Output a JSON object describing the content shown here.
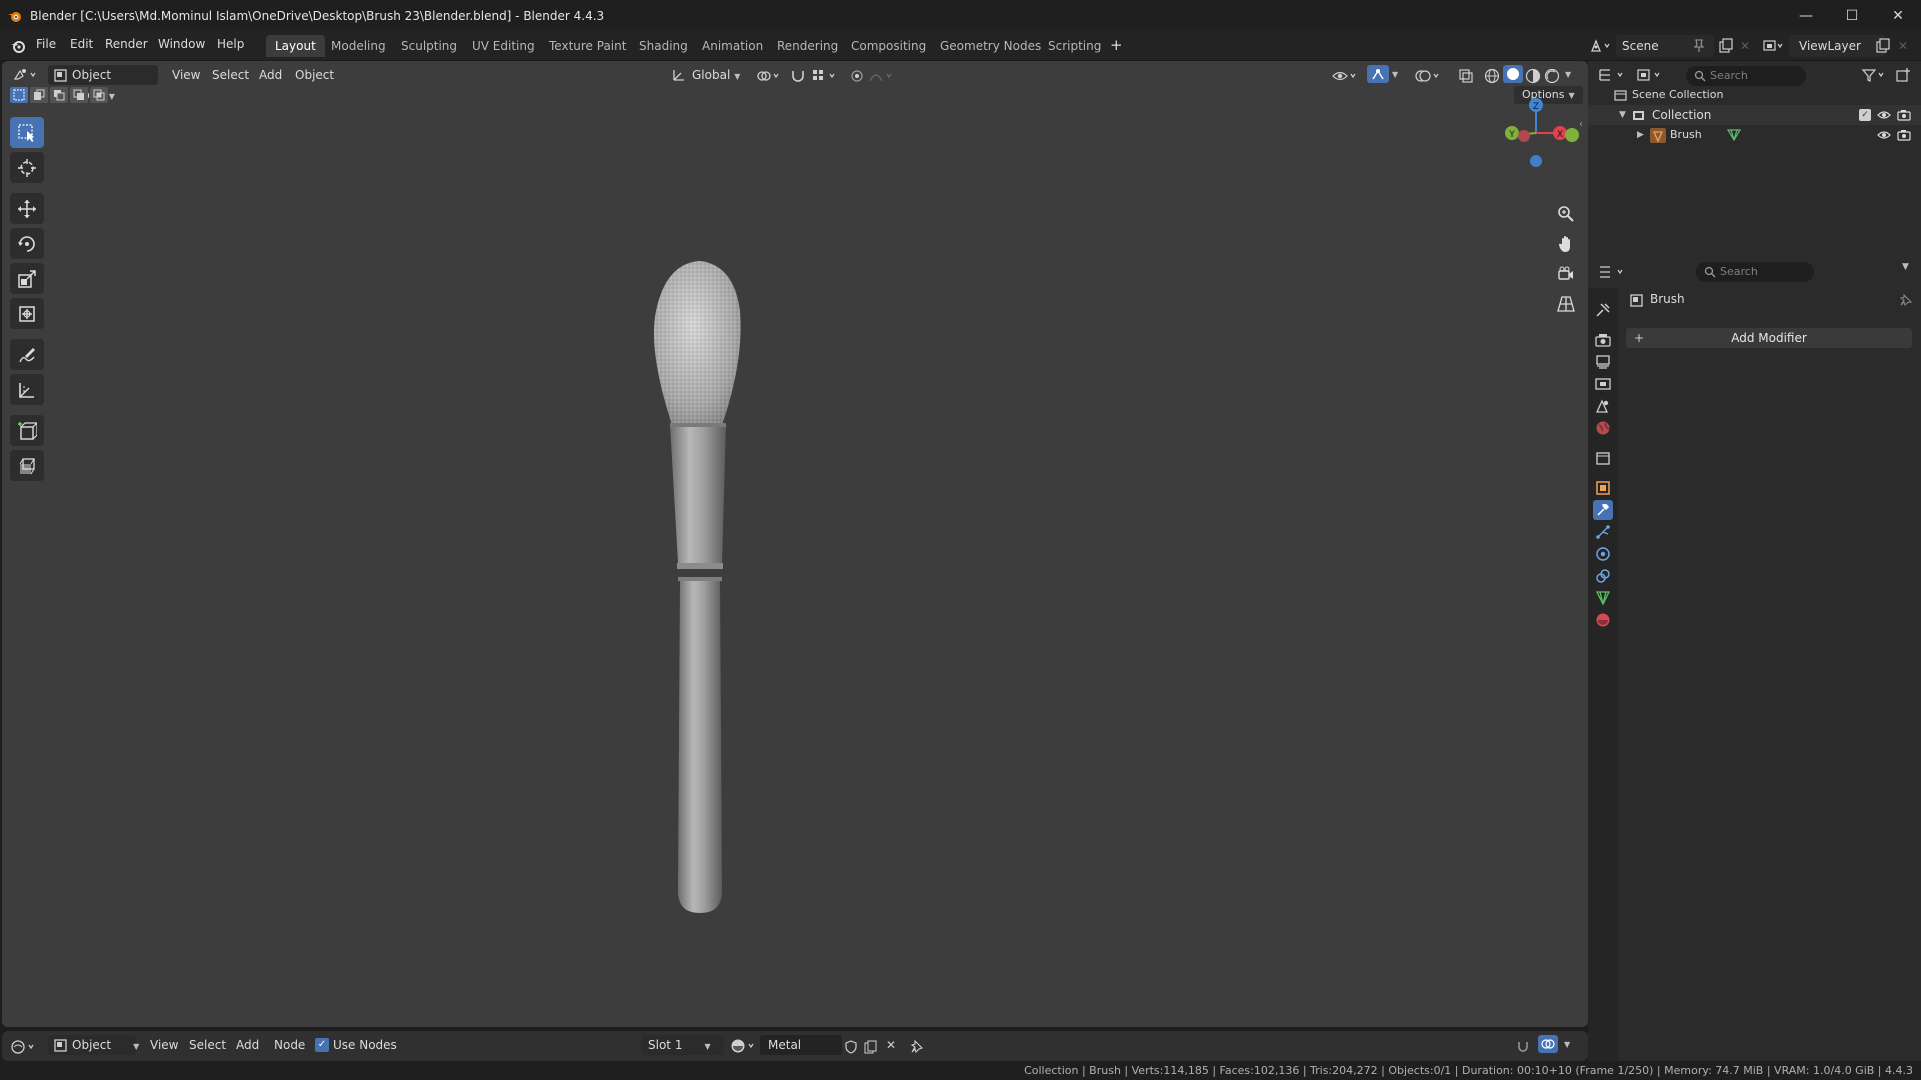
{
  "window": {
    "title": "Blender [C:\\Users\\Md.Mominul Islam\\OneDrive\\Desktop\\Brush 23\\Blender.blend] - Blender 4.4.3",
    "minimize": "—",
    "maximize": "☐",
    "close": "✕"
  },
  "menu": [
    "File",
    "Edit",
    "Render",
    "Window",
    "Help"
  ],
  "workspaces": [
    "Layout",
    "Modeling",
    "Sculpting",
    "UV Editing",
    "Texture Paint",
    "Shading",
    "Animation",
    "Rendering",
    "Compositing",
    "Geometry Nodes",
    "Scripting"
  ],
  "active_workspace": "Layout",
  "add_workspace": "+",
  "scene": {
    "name": "Scene",
    "view_layer": "ViewLayer"
  },
  "viewport": {
    "mode": "Object Mode",
    "menus": [
      "View",
      "Select",
      "Add",
      "Object"
    ],
    "orientation": "Global",
    "options": "Options",
    "gizmo": {
      "z": "Z",
      "y": "Y",
      "x": "X"
    }
  },
  "outliner": {
    "search_placeholder": "Search",
    "scene_collection": "Scene Collection",
    "collection": "Collection",
    "object": "Brush"
  },
  "properties": {
    "search_placeholder": "Search",
    "object_name": "Brush",
    "add_modifier": "Add Modifier",
    "add_modifier_icon": "+"
  },
  "shader_bar": {
    "mode": "Object",
    "menus": [
      "View",
      "Select",
      "Add",
      "Node"
    ],
    "use_nodes": "Use Nodes",
    "use_nodes_checked": true,
    "slot": "Slot 1",
    "material": "Metal"
  },
  "status": "Collection | Brush | Verts:114,185 | Faces:102,136 | Tris:204,272 | Objects:0/1 | Duration: 00:10+10 (Frame 1/250) | Memory: 74.7 MiB | VRAM: 1.0/4.0 GiB | 4.4.3",
  "colors": {
    "accent": "#4772b3",
    "viewport_bg": "#3d3d3d",
    "axis_x": "#e0424a",
    "axis_y": "#7fb23a",
    "axis_z": "#3f86d6"
  }
}
